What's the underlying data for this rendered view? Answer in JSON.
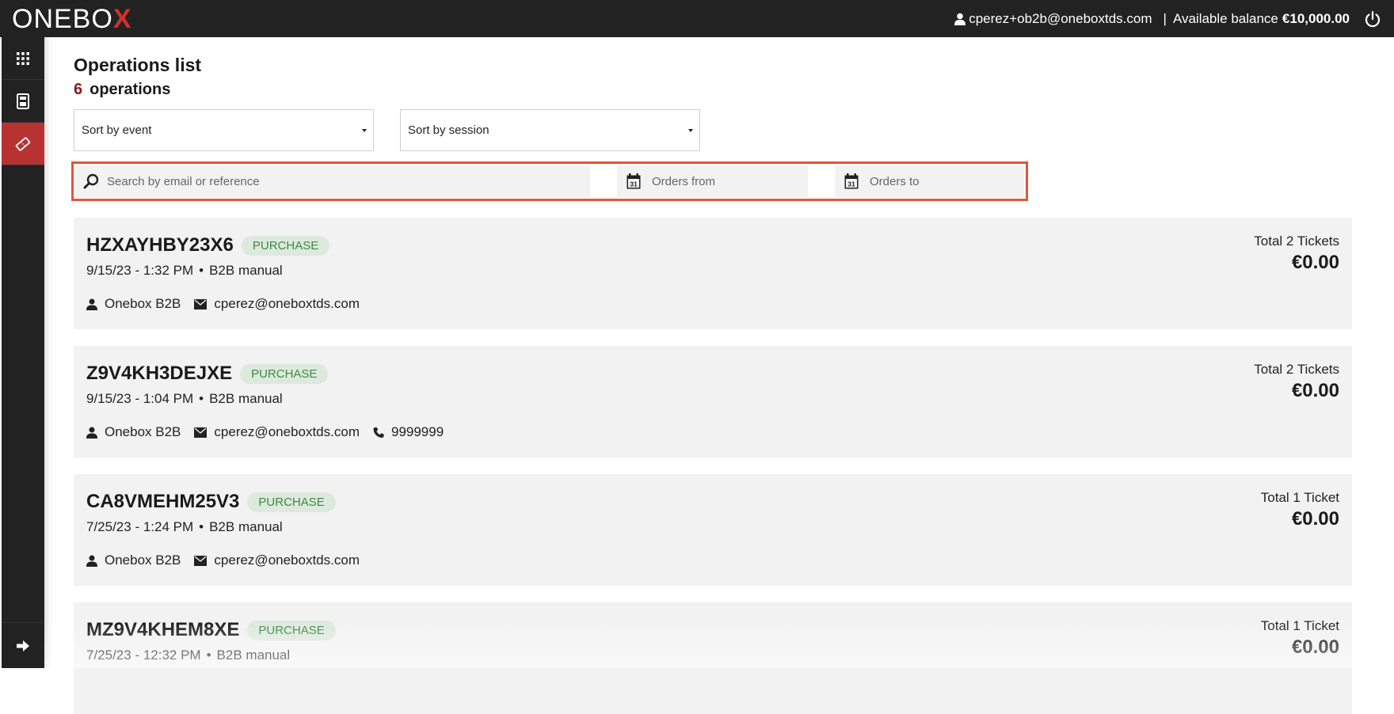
{
  "header": {
    "logo_main": "ONEBO",
    "logo_x": "X",
    "user_email": "cperez+ob2b@oneboxtds.com",
    "separator": "|",
    "balance_label": "Available balance",
    "balance_value": "€10,000.00"
  },
  "sidebar": {
    "items": [
      {
        "name": "apps",
        "icon": "grid-icon"
      },
      {
        "name": "orders",
        "icon": "calculator-icon"
      },
      {
        "name": "operations",
        "icon": "ticket-icon",
        "active": true
      }
    ],
    "bottom_icon": "arrow-right-icon"
  },
  "page": {
    "title": "Operations list",
    "count": "6",
    "count_label": "operations"
  },
  "filters": {
    "sort_event": "Sort by event",
    "sort_session": "Sort by session",
    "search_placeholder": "Search by email or reference",
    "orders_from": "Orders from",
    "orders_to": "Orders to"
  },
  "operations": [
    {
      "ref": "HZXAYHBY23X6",
      "badge": "PURCHASE",
      "date": "9/15/23 - 1:32 PM",
      "dot": "•",
      "channel": "B2B manual",
      "client": "Onebox B2B",
      "email": "cperez@oneboxtds.com",
      "phone": "",
      "total": "Total 2 Tickets",
      "amount": "€0.00"
    },
    {
      "ref": "Z9V4KH3DEJXE",
      "badge": "PURCHASE",
      "date": "9/15/23 - 1:04 PM",
      "dot": "•",
      "channel": "B2B manual",
      "client": "Onebox B2B",
      "email": "cperez@oneboxtds.com",
      "phone": "9999999",
      "total": "Total 2 Tickets",
      "amount": "€0.00"
    },
    {
      "ref": "CA8VMEHM25V3",
      "badge": "PURCHASE",
      "date": "7/25/23 - 1:24 PM",
      "dot": "•",
      "channel": "B2B manual",
      "client": "Onebox B2B",
      "email": "cperez@oneboxtds.com",
      "phone": "",
      "total": "Total 1 Ticket",
      "amount": "€0.00"
    },
    {
      "ref": "MZ9V4KHEM8XE",
      "badge": "PURCHASE",
      "date": "7/25/23 - 12:32 PM",
      "dot": "•",
      "channel": "B2B manual",
      "client": "",
      "email": "",
      "phone": "",
      "total": "Total 1 Ticket",
      "amount": "€0.00"
    }
  ],
  "colors": {
    "topbar": "#222222",
    "accent_red": "#b83232",
    "highlight_border": "#e0553d",
    "badge_bg": "#dde9dd",
    "badge_text": "#3e8a45",
    "card_bg": "#f2f2f2"
  }
}
